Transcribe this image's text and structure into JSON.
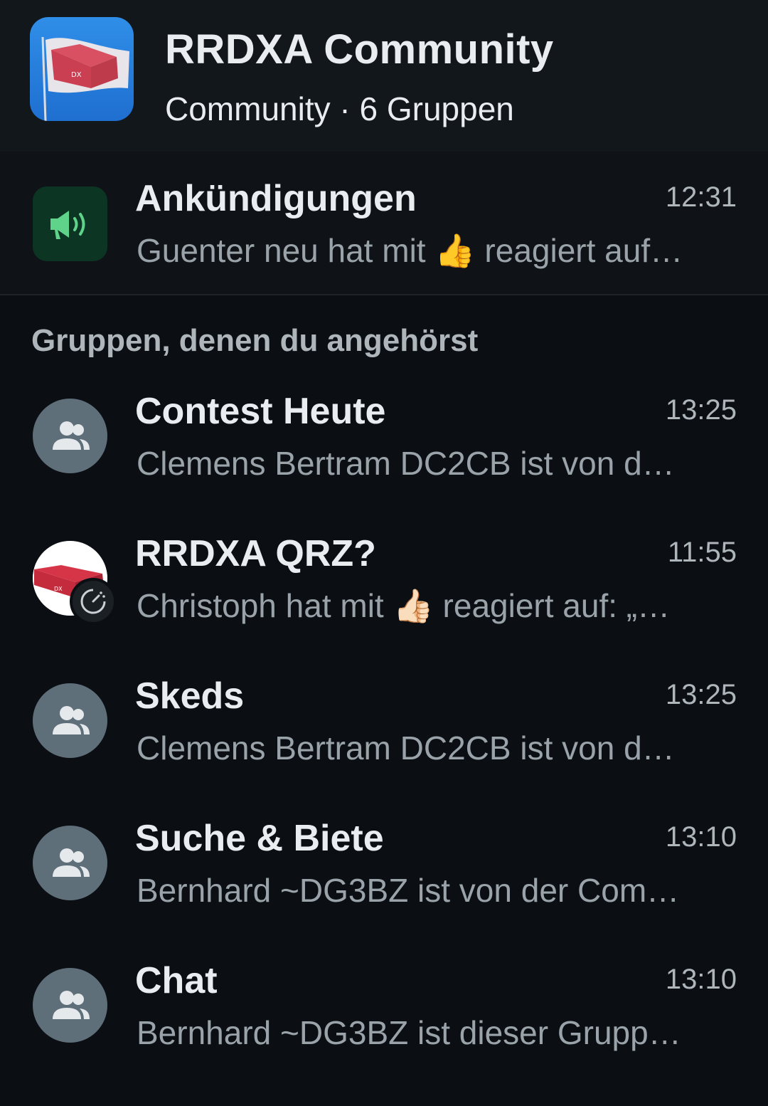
{
  "header": {
    "title": "RRDXA Community",
    "subtitle": "Community · 6 Gruppen",
    "avatar_icon": "flag-icon"
  },
  "announcements": {
    "title": "Ankündigungen",
    "time": "12:31",
    "preview_before": "Guenter neu hat mit ",
    "preview_emoji": "👍",
    "preview_after": " reagiert auf…",
    "icon": "megaphone-icon"
  },
  "section_label": "Gruppen, denen du angehörst",
  "groups": [
    {
      "title": "Contest Heute",
      "time": "13:25",
      "preview": "Clemens Bertram DC2CB ist von d…",
      "icon": "group-icon"
    },
    {
      "title": "RRDXA QRZ?",
      "time": "11:55",
      "preview_before": "Christoph hat mit ",
      "preview_emoji": "👍🏻",
      "preview_after": " reagiert auf: „…",
      "icon": "rrdxa-logo",
      "badge": "disappearing-timer-icon"
    },
    {
      "title": "Skeds",
      "time": "13:25",
      "preview": "Clemens Bertram DC2CB ist von d…",
      "icon": "group-icon"
    },
    {
      "title": "Suche & Biete",
      "time": "13:10",
      "preview": "Bernhard ~DG3BZ ist von der Com…",
      "icon": "group-icon"
    },
    {
      "title": "Chat",
      "time": "13:10",
      "preview": "Bernhard ~DG3BZ ist dieser Grupp…",
      "icon": "group-icon"
    }
  ],
  "colors": {
    "background": "#0b0f14",
    "header": "#12171c",
    "announce_icon_bg": "#0c3523",
    "announce_icon_fg": "#5fd38a",
    "group_icon_bg": "#5f6f7a",
    "text_primary": "#e9edef",
    "text_secondary": "#9aa3a9"
  }
}
